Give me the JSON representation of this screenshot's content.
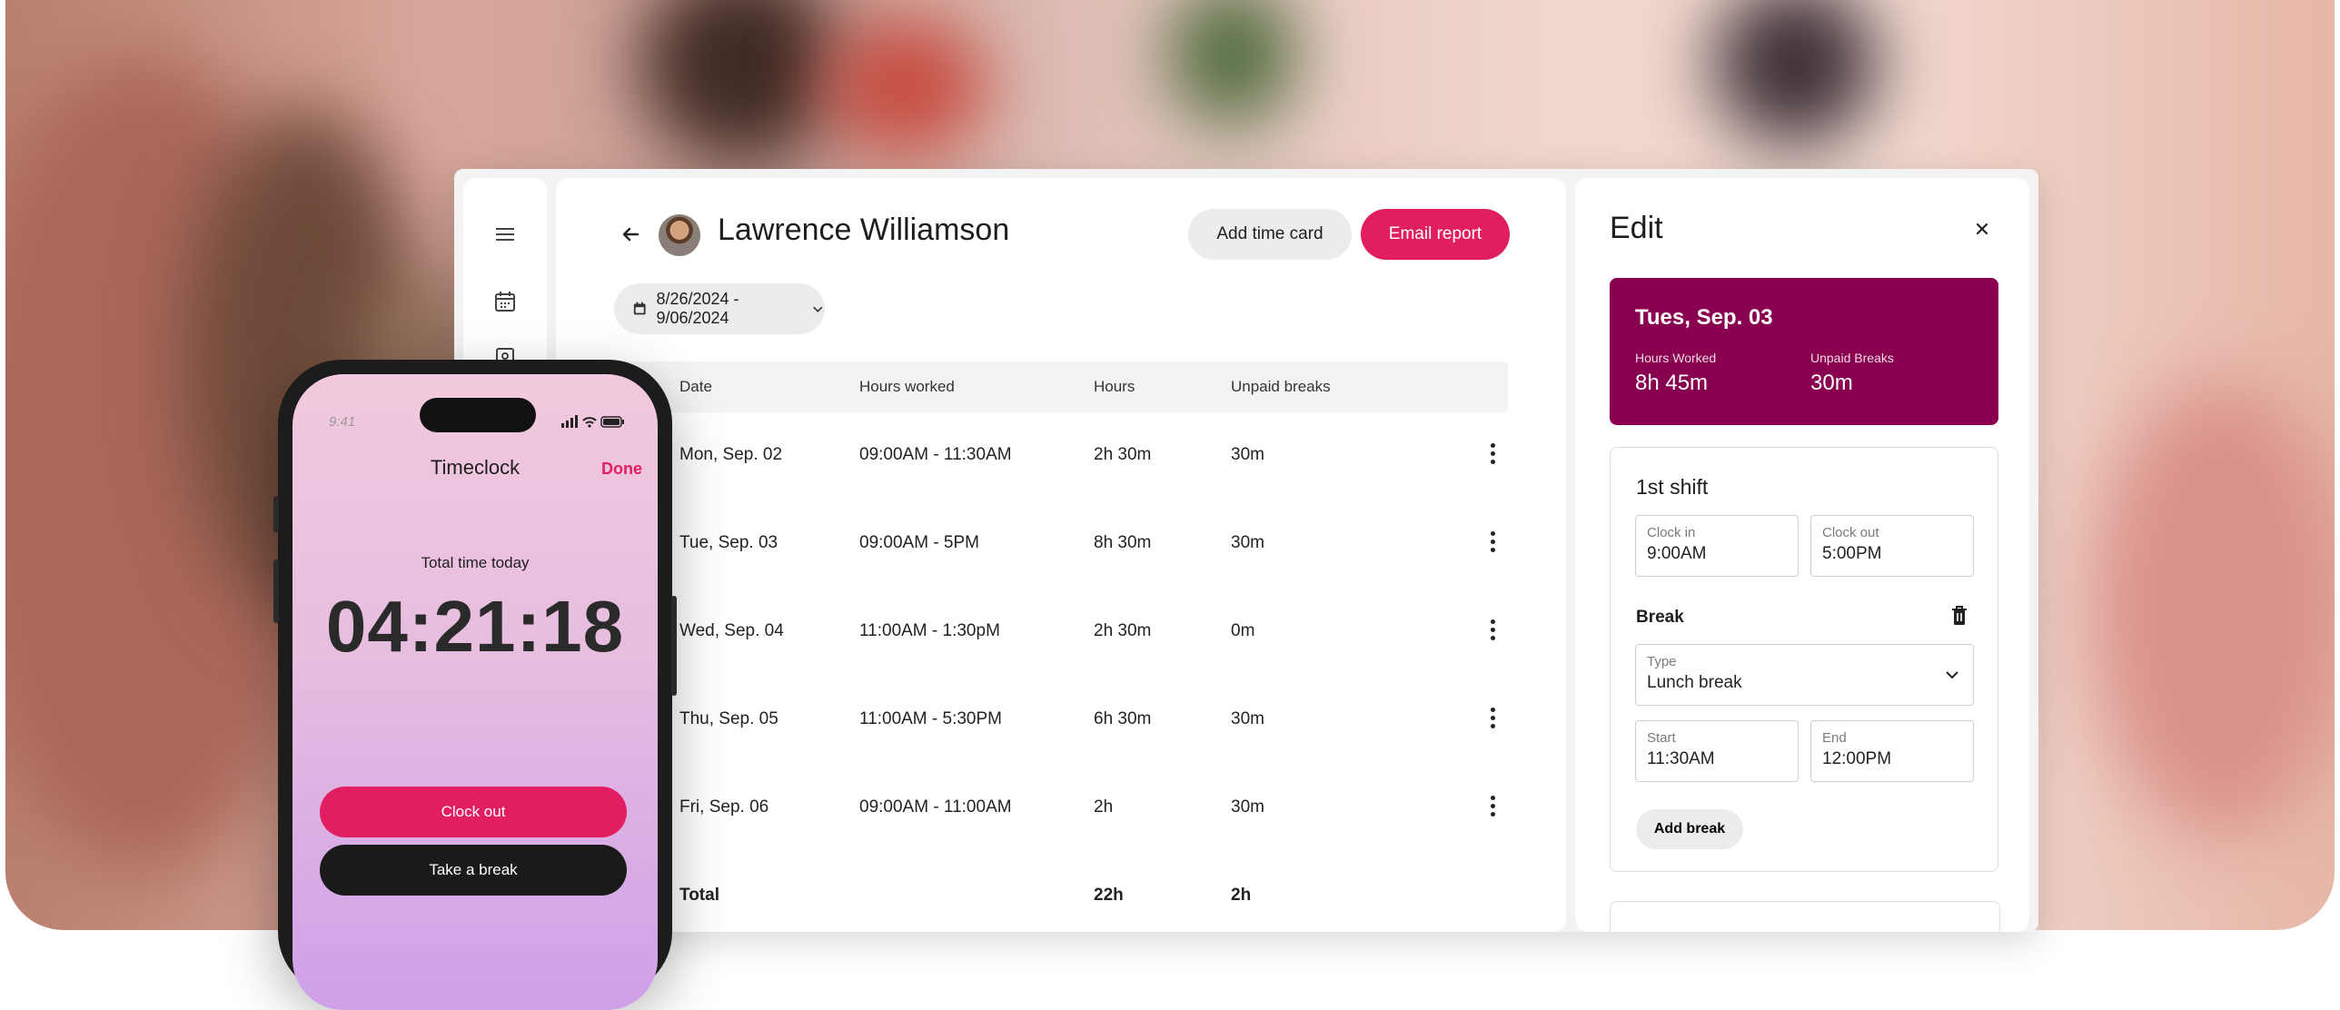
{
  "colors": {
    "accent": "#e21e62",
    "day_card": "#8a0050",
    "table_head": "#f3f3f3"
  },
  "header": {
    "back_icon": "arrow-left-icon",
    "name": "Lawrence Williamson",
    "add_time_card": "Add time card",
    "email_report": "Email report"
  },
  "date_range": {
    "icon": "calendar-icon",
    "label": "8/26/2024 - 9/06/2024",
    "chevron": "chevron-down-icon"
  },
  "sidebar": {
    "icons": [
      "menu-icon",
      "calendar-icon",
      "contacts-icon"
    ]
  },
  "table": {
    "headers": [
      "Date",
      "Hours worked",
      "Hours",
      "Unpaid breaks"
    ],
    "rows": [
      {
        "date": "Mon, Sep. 02",
        "worked": "09:00AM - 11:30AM",
        "hours": "2h 30m",
        "breaks": "30m"
      },
      {
        "date": "Tue, Sep. 03",
        "worked": "09:00AM - 5PM",
        "hours": "8h 30m",
        "breaks": "30m"
      },
      {
        "date": "Wed, Sep. 04",
        "worked": "11:00AM - 1:30pM",
        "hours": "2h 30m",
        "breaks": "0m"
      },
      {
        "date": "Thu, Sep. 05",
        "worked": "11:00AM - 5:30PM",
        "hours": "6h 30m",
        "breaks": "30m"
      },
      {
        "date": "Fri, Sep. 06",
        "worked": "09:00AM - 11:00AM",
        "hours": "2h",
        "breaks": "30m"
      }
    ],
    "total": {
      "label": "Total",
      "hours": "22h",
      "breaks": "2h"
    }
  },
  "edit": {
    "title": "Edit",
    "day": {
      "title": "Tues, Sep. 03",
      "hours_label": "Hours Worked",
      "hours_value": "8h 45m",
      "breaks_label": "Unpaid Breaks",
      "breaks_value": "30m"
    },
    "shift": {
      "title": "1st shift",
      "clock_in_label": "Clock in",
      "clock_in_value": "9:00AM",
      "clock_out_label": "Clock out",
      "clock_out_value": "5:00PM",
      "break_label": "Break",
      "type_label": "Type",
      "type_value": "Lunch break",
      "start_label": "Start",
      "start_value": "11:30AM",
      "end_label": "End",
      "end_value": "12:00PM",
      "add_break": "Add break"
    }
  },
  "phone": {
    "status_time": "9:41",
    "title": "Timeclock",
    "done": "Done",
    "total_label": "Total time today",
    "clock": "04:21:18",
    "clock_out": "Clock out",
    "take_break": "Take a break"
  }
}
